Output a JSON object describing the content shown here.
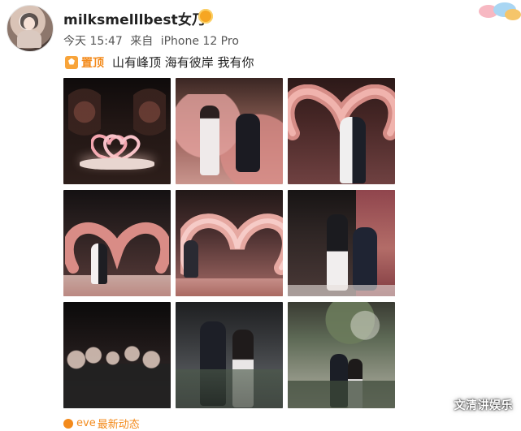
{
  "post": {
    "username": "milksmelllbest女乃",
    "badge_text": "",
    "time": "今天 15:47",
    "source_prefix": "来自",
    "device": "iPhone 12 Pro",
    "pinned_label": "置顶",
    "content": "山有峰顶 海有彼岸 我有你"
  },
  "footer": {
    "prefix": "eve",
    "text": "最新动态"
  },
  "watermark": "文清讲娱乐",
  "colors": {
    "accent": "#f38a1b",
    "text_primary": "#222222",
    "text_secondary": "#555555"
  }
}
